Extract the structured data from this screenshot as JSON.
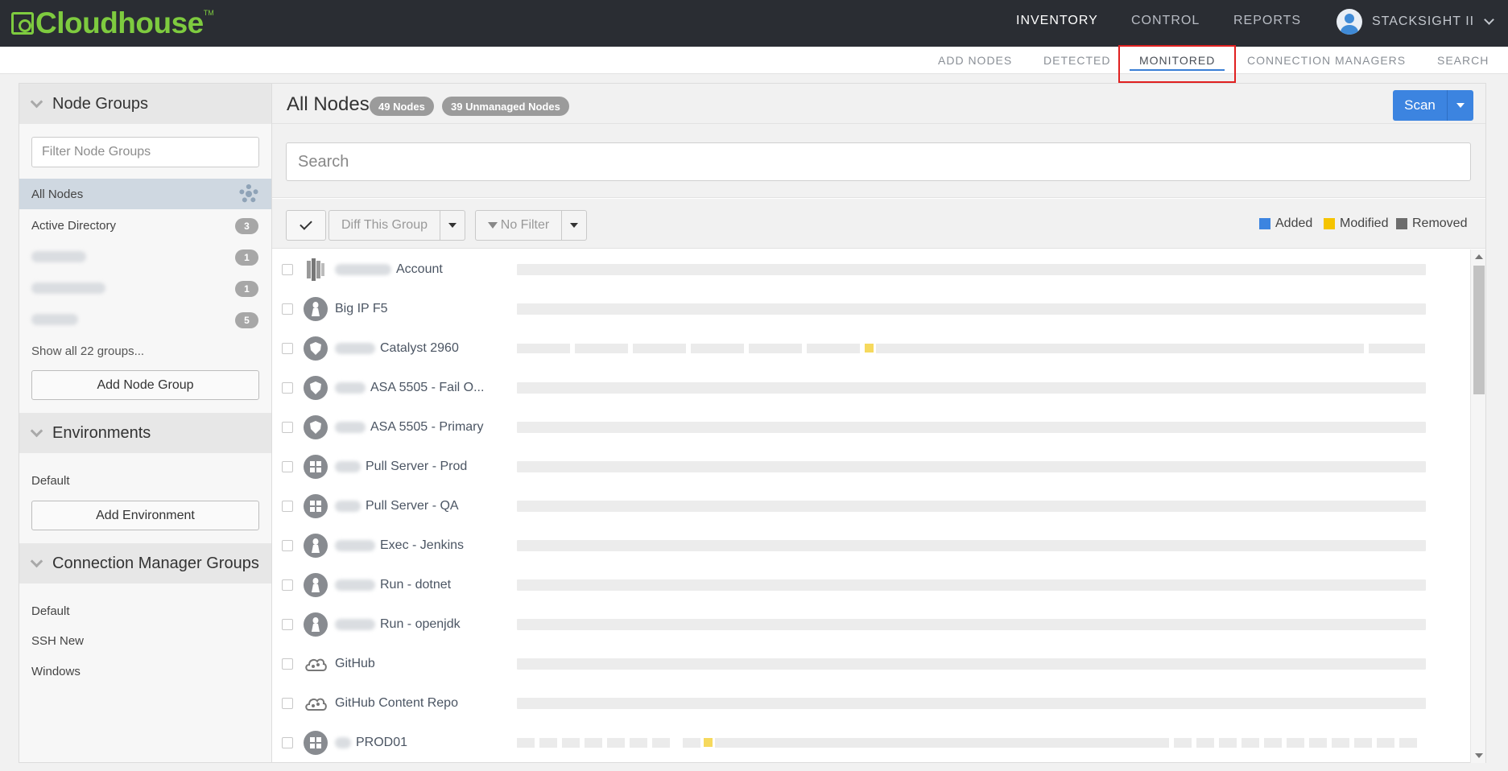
{
  "app": {
    "logo": "Cloudhouse",
    "logo_tm": "TM"
  },
  "topnav": {
    "inventory": "INVENTORY",
    "control": "CONTROL",
    "reports": "REPORTS",
    "user": "STACKSIGHT II"
  },
  "subnav": {
    "add_nodes": "ADD NODES",
    "detected": "DETECTED",
    "monitored": "MONITORED",
    "connection_managers": "CONNECTION MANAGERS",
    "search": "SEARCH"
  },
  "sidebar": {
    "node_groups_title": "Node Groups",
    "filter_placeholder": "Filter Node Groups",
    "groups": [
      {
        "label": "All Nodes",
        "count": ""
      },
      {
        "label": "Active Directory",
        "count": "3"
      },
      {
        "label": "",
        "count": "1"
      },
      {
        "label": "",
        "count": "1"
      },
      {
        "label": "",
        "count": "5"
      }
    ],
    "show_all": "Show all 22 groups...",
    "add_node_group": "Add Node Group",
    "environments_title": "Environments",
    "environments": [
      "Default"
    ],
    "add_environment": "Add Environment",
    "cm_groups_title": "Connection Manager Groups",
    "cm_groups": [
      "Default",
      "SSH New",
      "Windows"
    ]
  },
  "main": {
    "title": "All Nodes",
    "nodes_count": "49 Nodes",
    "unmanaged_count": "39 Unmanaged Nodes",
    "scan_label": "Scan",
    "search_placeholder": "Search",
    "diff_label": "Diff This Group",
    "filter_label": "No Filter",
    "legend": {
      "added": "Added",
      "modified": "Modified",
      "removed": "Removed"
    },
    "colors": {
      "added": "#3c84e0",
      "modified": "#f5c400",
      "removed": "#6d6d6d",
      "accent": "#3c84e0",
      "logo_green": "#7ecb3f"
    }
  },
  "nodes": [
    {
      "name": "Account",
      "icon": "aws-icon"
    },
    {
      "name": "Big IP F5",
      "icon": "linux-icon"
    },
    {
      "name": "Catalyst 2960",
      "icon": "network-device-icon"
    },
    {
      "name": "ASA 5505 - Fail O...",
      "icon": "network-device-icon"
    },
    {
      "name": "ASA 5505 - Primary",
      "icon": "network-device-icon"
    },
    {
      "name": "Pull Server - Prod",
      "icon": "windows-icon"
    },
    {
      "name": "Pull Server - QA",
      "icon": "windows-icon"
    },
    {
      "name": "Exec - Jenkins",
      "icon": "linux-icon"
    },
    {
      "name": "Run - dotnet",
      "icon": "linux-icon"
    },
    {
      "name": "Run - openjdk",
      "icon": "linux-icon"
    },
    {
      "name": "GitHub",
      "icon": "cloud-icon"
    },
    {
      "name": "GitHub Content Repo",
      "icon": "cloud-icon"
    },
    {
      "name": "PROD01",
      "icon": "windows-icon"
    }
  ]
}
